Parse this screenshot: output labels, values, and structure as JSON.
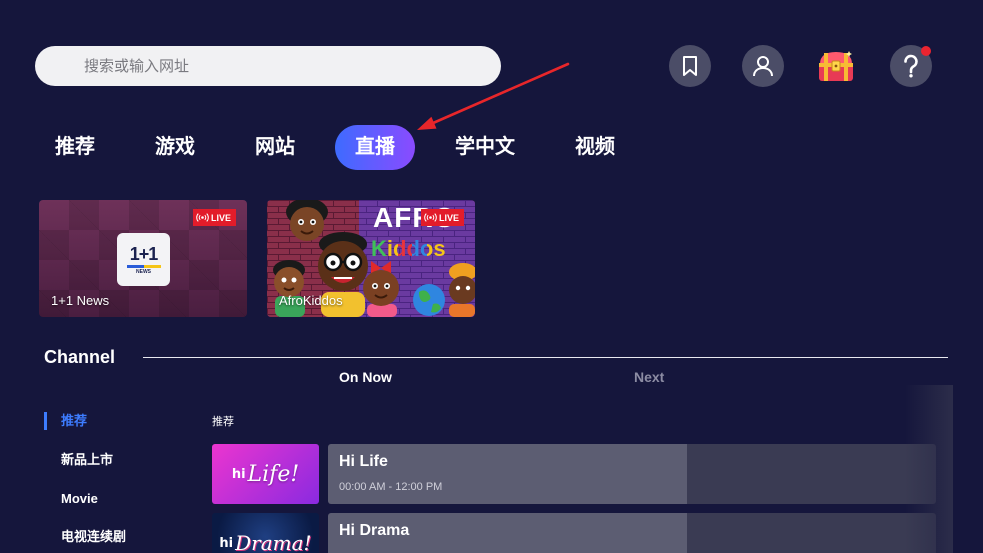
{
  "search": {
    "placeholder": "搜索或输入网址"
  },
  "header": {
    "icons": [
      "bookmark-icon",
      "user-icon",
      "treasure-chest-icon",
      "help-icon"
    ],
    "help_notification": true
  },
  "tabs": [
    {
      "label": "推荐",
      "active": false
    },
    {
      "label": "游戏",
      "active": false
    },
    {
      "label": "网站",
      "active": false
    },
    {
      "label": "直播",
      "active": true
    },
    {
      "label": "学中文",
      "active": false
    },
    {
      "label": "视频",
      "active": false
    }
  ],
  "live_cards": [
    {
      "title": "1+1 News",
      "badge": "LIVE",
      "badge_icon": "broadcast-icon",
      "logo_text": "1+1",
      "logo_subtext": "NEWS"
    },
    {
      "title": "AfroKiddos",
      "badge": "LIVE",
      "badge_icon": "broadcast-icon",
      "art_title_top": "AFRO",
      "art_title_bottom": "Kiddos"
    }
  ],
  "channel": {
    "heading": "Channel",
    "col_now": "On Now",
    "col_next": "Next",
    "categories": [
      {
        "label": "推荐",
        "active": true
      },
      {
        "label": "新品上市",
        "active": false
      },
      {
        "label": "Movie",
        "active": false
      },
      {
        "label": "电视连续剧",
        "active": false
      }
    ],
    "section_label": "推荐",
    "rows": [
      {
        "logo_prefix": "hi",
        "logo_name": "Life!",
        "now_title": "Hi Life",
        "now_time": "00:00 AM - 12:00 PM"
      },
      {
        "logo_prefix": "hi",
        "logo_name": "Drama!",
        "now_title": "Hi Drama"
      }
    ]
  },
  "colors": {
    "background": "#15163c",
    "accent": "#3d7cff",
    "tab_active_start": "#3e6bff",
    "tab_active_end": "#8a4bff",
    "live_badge": "#e21c2a",
    "notification_dot": "#ea2430",
    "icon_circle": "#4b4d67",
    "now_cell": "#5c5d72",
    "next_cell": "#3a3b53",
    "muted_text": "#8c8ca3",
    "annotation_arrow": "#e8262a"
  }
}
